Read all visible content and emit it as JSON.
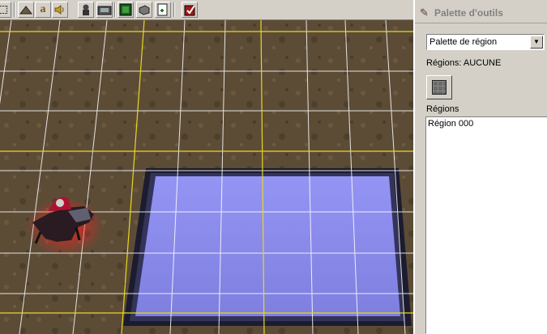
{
  "toolbar": {
    "buttons": [
      {
        "icon": "select-icon"
      },
      {
        "icon": "terrain-icon"
      },
      {
        "icon": "doodad-icon",
        "glyph": "a"
      },
      {
        "icon": "sound-icon"
      },
      {
        "icon": "unit-icon"
      },
      {
        "icon": "camera-icon"
      },
      {
        "icon": "trigger-editor-icon"
      },
      {
        "icon": "object-editor-icon"
      },
      {
        "icon": "import-icon"
      },
      {
        "icon": "test-map-icon"
      }
    ]
  },
  "palette": {
    "title": "Palette d'outils",
    "dropdown_value": "Palette de région",
    "regions_label": "Régions: AUCUNE",
    "list_label": "Régions",
    "items": [
      "Région 000"
    ]
  },
  "colors": {
    "grid_white": "#ffffff",
    "grid_yellow": "#e8d820",
    "region_fill": "#8c8cf0",
    "region_border": "#2a2a4a",
    "ground": "#5a4a35"
  }
}
